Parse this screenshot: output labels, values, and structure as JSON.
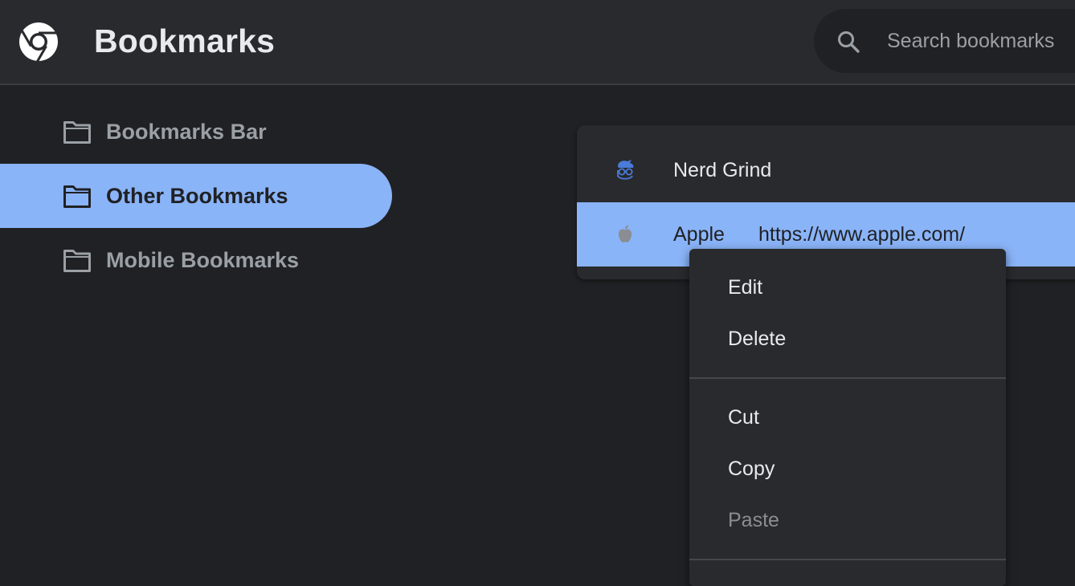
{
  "header": {
    "title": "Bookmarks",
    "logo_icon": "chrome-logo-icon",
    "search_icon": "search-icon",
    "search_placeholder": "Search bookmarks"
  },
  "sidebar": {
    "items": [
      {
        "label": "Bookmarks Bar",
        "icon": "folder-icon",
        "selected": false
      },
      {
        "label": "Other Bookmarks",
        "icon": "folder-icon",
        "selected": true
      },
      {
        "label": "Mobile Bookmarks",
        "icon": "folder-icon",
        "selected": false
      }
    ]
  },
  "bookmarks": [
    {
      "title": "Nerd Grind",
      "url": "",
      "icon": "nerd-grind-favicon-icon",
      "selected": false
    },
    {
      "title": "Apple",
      "url": "https://www.apple.com/",
      "icon": "apple-favicon-icon",
      "selected": true
    }
  ],
  "context_menu": {
    "items": [
      {
        "label": "Edit",
        "enabled": true
      },
      {
        "label": "Delete",
        "enabled": true
      },
      {
        "label": "Cut",
        "enabled": true
      },
      {
        "label": "Copy",
        "enabled": true
      },
      {
        "label": "Paste",
        "enabled": false
      }
    ]
  },
  "colors": {
    "background": "#202124",
    "toolbar": "#292a2d",
    "accent": "#8ab4f8",
    "text_primary": "#e8eaed",
    "text_secondary": "#9aa0a6"
  }
}
